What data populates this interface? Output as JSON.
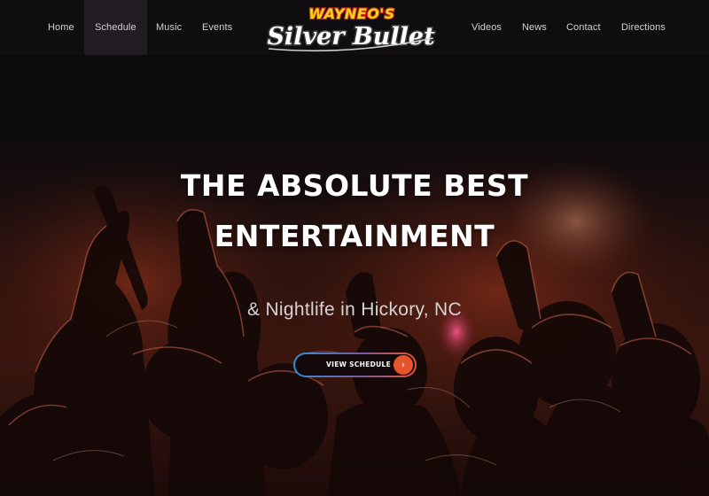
{
  "nav": {
    "left": [
      "Home",
      "Schedule",
      "Music",
      "Events"
    ],
    "right": [
      "Videos",
      "News",
      "Contact",
      "Directions"
    ],
    "active": "Schedule"
  },
  "logo": {
    "line1": "WAYNEO'S",
    "line2": "Silver Bullet"
  },
  "hero": {
    "headline_line1": "THE ABSOLUTE BEST",
    "headline_line2": "ENTERTAINMENT",
    "subhead": "& Nightlife in Hickory, NC",
    "cta_label": "VIEW SCHEDULE",
    "cta_icon": "chevron-right-icon"
  },
  "colors": {
    "accent_orange": "#e8552a",
    "accent_blue": "#2f8fd8",
    "logo_yellow": "#f6d31a",
    "logo_red": "#d42a1e"
  }
}
